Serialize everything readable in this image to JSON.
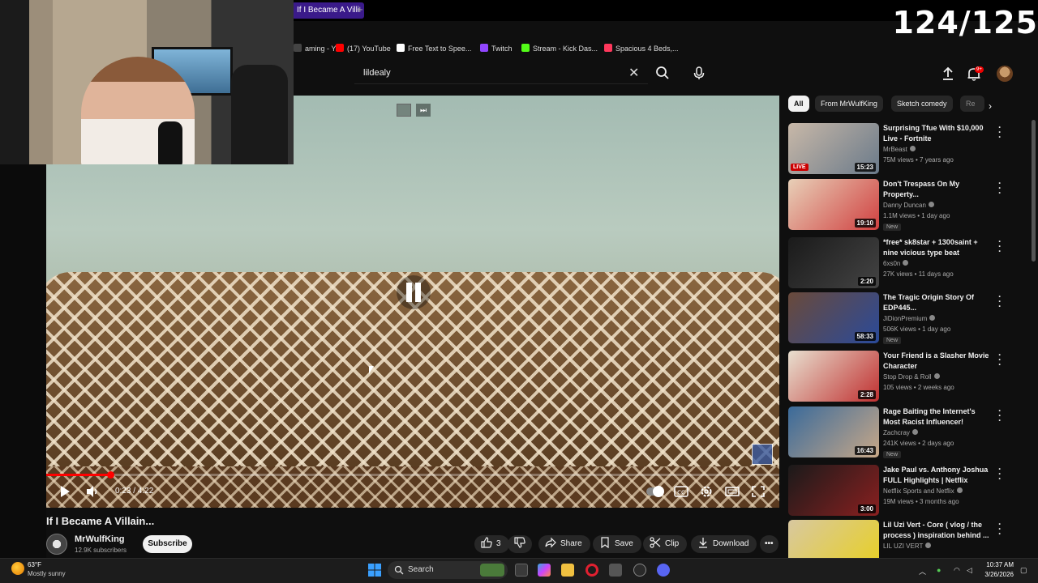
{
  "browser": {
    "active_tab": "If I Became A Villi",
    "new_tab_symbol": "+",
    "bookmarks": [
      {
        "label": "aming - Y...",
        "color": "#444444"
      },
      {
        "label": "(17) YouTube",
        "color": "#ff0000"
      },
      {
        "label": "Free Text to Spee...",
        "color": "#ffffff"
      },
      {
        "label": "Twitch",
        "color": "#9146ff"
      },
      {
        "label": "Stream - Kick Das...",
        "color": "#53fc18"
      },
      {
        "label": "Spacious 4 Beds,...",
        "color": "#ff385c"
      }
    ]
  },
  "stream_overlay": {
    "counter": "124/125"
  },
  "header": {
    "search_value": "lildealy",
    "notification_badge": "9+"
  },
  "player": {
    "time": "0:23 / 4:22",
    "progress": 0.0878
  },
  "video": {
    "title": "If I Became A Villain...",
    "channel": "MrWulfKing",
    "subscribers": "12.9K subscribers",
    "subscribe_label": "Subscribe",
    "likes": "3",
    "share_label": "Share",
    "save_label": "Save",
    "clip_label": "Clip",
    "download_label": "Download"
  },
  "sidebar": {
    "chips": [
      "All",
      "From MrWulfKing",
      "Sketch comedy",
      "Re"
    ],
    "recommendations": [
      {
        "title": "Surprising Tfue With $10,000 Live - Fortnite",
        "channel": "MrBeast",
        "meta": "75M views • 7 years ago",
        "duration": "15:23",
        "badge": "LIVE",
        "new": "",
        "colors": [
          "#c8b8a8",
          "#6a7a8a"
        ]
      },
      {
        "title": "Don't Trespass On My Property...",
        "channel": "Danny Duncan",
        "meta": "1.1M views • 1 day ago",
        "duration": "19:10",
        "badge": "",
        "new": "New",
        "colors": [
          "#e8d0b8",
          "#d04040"
        ]
      },
      {
        "title": "*free* sk8star + 1300saint + nine vicious type beat",
        "channel": "6xs0n",
        "meta": "27K views • 11 days ago",
        "duration": "2:20",
        "badge": "",
        "new": "",
        "colors": [
          "#1a1a1a",
          "#444444"
        ]
      },
      {
        "title": "The Tragic Origin Story Of EDP445...",
        "channel": "JiDionPremium",
        "meta": "506K views • 1 day ago",
        "duration": "58:33",
        "badge": "",
        "new": "New",
        "colors": [
          "#6a4a3a",
          "#2a4a9a"
        ]
      },
      {
        "title": "Your Friend is a Slasher Movie Character",
        "channel": "Stop Drop & Roll",
        "meta": "105 views • 2 weeks ago",
        "duration": "2:28",
        "badge": "",
        "new": "",
        "colors": [
          "#e8e0d0",
          "#c03030"
        ]
      },
      {
        "title": "Rage Baiting the Internet's Most Racist Influencer!",
        "channel": "Zachcray",
        "meta": "241K views • 2 days ago",
        "duration": "16:43",
        "badge": "",
        "new": "New",
        "colors": [
          "#3a6a9a",
          "#c8a888"
        ]
      },
      {
        "title": "Jake Paul vs. Anthony Joshua FULL Highlights | Netflix",
        "channel": "Netflix Sports and Netflix",
        "meta": "19M views • 3 months ago",
        "duration": "3:00",
        "badge": "",
        "new": "",
        "colors": [
          "#1a1a1a",
          "#8a2020"
        ]
      },
      {
        "title": "Lil Uzi Vert - Core ( vlog / the process ) inspiration behind ...",
        "channel": "LIL UZI VERT",
        "meta": "",
        "duration": "",
        "badge": "",
        "new": "",
        "colors": [
          "#d8c8a0",
          "#e8d020"
        ]
      }
    ]
  },
  "taskbar": {
    "temperature": "63°F",
    "weather": "Mostly sunny",
    "search_label": "Search",
    "time": "10:37 AM",
    "date": "3/26/2026"
  }
}
